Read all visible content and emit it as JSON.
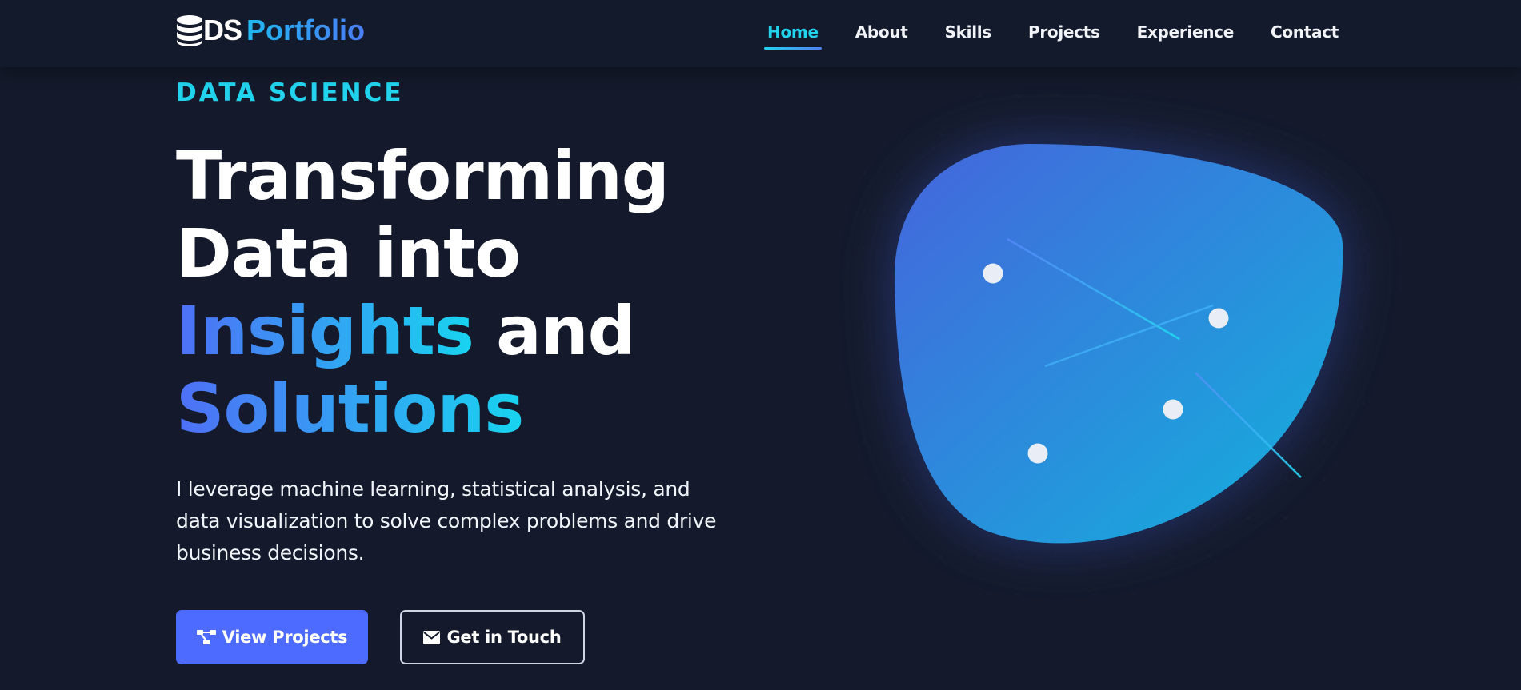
{
  "brand": {
    "logo_icon": "database-icon",
    "ds_label": "DS",
    "portfolio_label": "Portfolio"
  },
  "nav": {
    "items": [
      {
        "label": "Home",
        "active": true
      },
      {
        "label": "About"
      },
      {
        "label": "Skills"
      },
      {
        "label": "Projects"
      },
      {
        "label": "Experience"
      },
      {
        "label": "Contact"
      }
    ]
  },
  "hero": {
    "eyebrow": "DATA SCIENCE",
    "headline_line1": "Transforming",
    "headline_line2": "Data into",
    "headline_highlight1": "Insights",
    "headline_and": " and",
    "headline_highlight2": "Solutions",
    "lead": "I leverage machine learning, statistical analysis, and data visualization to solve complex problems and drive business decisions.",
    "primary_button": {
      "label": "View Projects",
      "icon": "project-diagram-icon"
    },
    "secondary_button": {
      "label": "Get in Touch",
      "icon": "envelope-icon"
    }
  },
  "colors": {
    "background": "#141a2b",
    "accent_cyan": "#22d3ee",
    "accent_blue": "#4d6bfe",
    "blob_gradient_start": "#4565dc",
    "blob_gradient_end": "#12b2dc"
  }
}
